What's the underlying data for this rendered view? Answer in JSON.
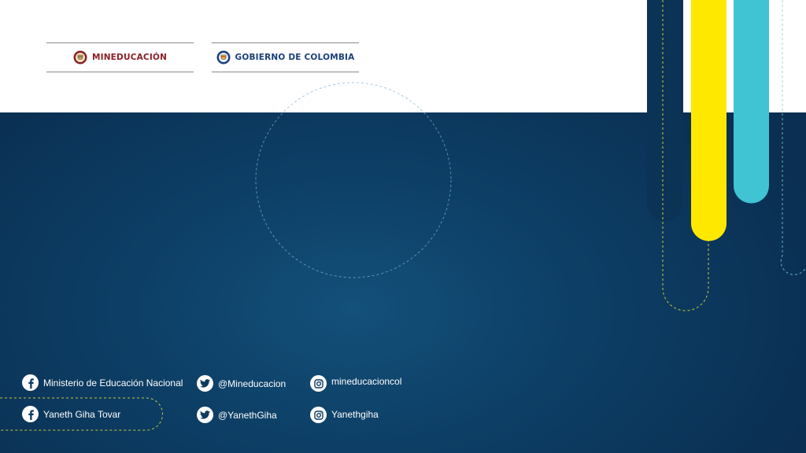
{
  "logos": {
    "ministry": "MINEDUCACIÓN",
    "government": "GOBIERNO DE COLOMBIA"
  },
  "social": {
    "row1": {
      "facebook": "Ministerio de Educación Nacional",
      "twitter": "@Mineducacion",
      "instagram": "mineducacioncol"
    },
    "row2": {
      "facebook": "Yaneth Giha Tovar",
      "twitter": "@YanethGiha",
      "instagram": "Yanethgiha"
    }
  },
  "colors": {
    "navy": "#0d3a5e",
    "yellow": "#ffe800",
    "cyan": "#40c4d4",
    "ministry_red": "#8b1f25",
    "government_blue": "#1b3f7a"
  },
  "icons": [
    "ministry-seal-icon",
    "colombia-seal-icon",
    "facebook-icon",
    "twitter-icon",
    "instagram-icon"
  ]
}
